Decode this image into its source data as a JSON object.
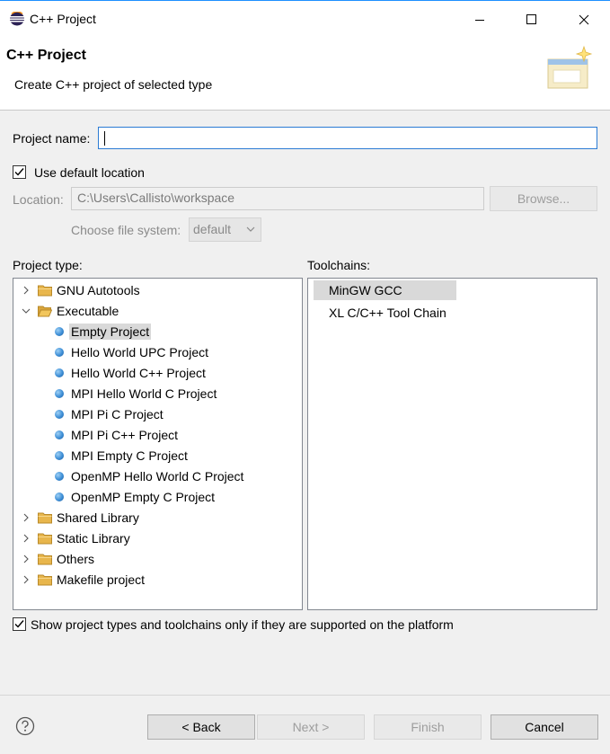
{
  "window": {
    "title": "C++ Project",
    "icon": "eclipse-icon"
  },
  "header": {
    "title": "C++ Project",
    "subtitle": "Create C++ project of selected type"
  },
  "form": {
    "project_name_label": "Project name:",
    "project_name_value": "",
    "use_default_location_label": "Use default location",
    "use_default_location_checked": true,
    "location_label": "Location:",
    "location_value": "C:\\Users\\Callisto\\workspace",
    "browse_label": "Browse...",
    "file_system_label": "Choose file system:",
    "file_system_value": "default"
  },
  "project_type": {
    "label": "Project type:",
    "items": [
      {
        "label": "GNU Autotools",
        "kind": "folder",
        "expanded": false
      },
      {
        "label": "Executable",
        "kind": "folder",
        "expanded": true
      },
      {
        "label": "Empty Project",
        "kind": "leaf",
        "selected": true
      },
      {
        "label": "Hello World UPC Project",
        "kind": "leaf"
      },
      {
        "label": "Hello World C++ Project",
        "kind": "leaf"
      },
      {
        "label": "MPI Hello World C Project",
        "kind": "leaf"
      },
      {
        "label": "MPI Pi C Project",
        "kind": "leaf"
      },
      {
        "label": "MPI Pi C++ Project",
        "kind": "leaf"
      },
      {
        "label": "MPI Empty C Project",
        "kind": "leaf"
      },
      {
        "label": "OpenMP Hello World C Project",
        "kind": "leaf"
      },
      {
        "label": "OpenMP Empty C Project",
        "kind": "leaf"
      },
      {
        "label": "Shared Library",
        "kind": "folder",
        "expanded": false
      },
      {
        "label": "Static Library",
        "kind": "folder",
        "expanded": false
      },
      {
        "label": "Others",
        "kind": "folder",
        "expanded": false
      },
      {
        "label": "Makefile project",
        "kind": "folder",
        "expanded": false
      }
    ]
  },
  "toolchains": {
    "label": "Toolchains:",
    "items": [
      {
        "label": "MinGW GCC",
        "selected": true
      },
      {
        "label": "XL C/C++ Tool Chain"
      }
    ]
  },
  "filter": {
    "label": "Show project types and toolchains only if they are supported on the platform",
    "checked": true
  },
  "buttons": {
    "back": "< Back",
    "next": "Next >",
    "finish": "Finish",
    "cancel": "Cancel"
  },
  "colors": {
    "focus_border": "#2b7bd4",
    "selection": "#d9d9d9",
    "folder": "#e8b64c"
  }
}
